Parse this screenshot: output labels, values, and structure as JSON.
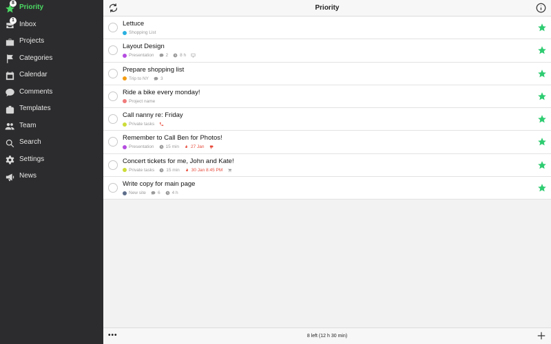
{
  "sidebar": {
    "items": [
      {
        "label": "Priority",
        "icon": "star-icon",
        "badge": "8",
        "active": true
      },
      {
        "label": "Inbox",
        "icon": "inbox-icon",
        "badge": "1"
      },
      {
        "label": "Projects",
        "icon": "briefcase-icon"
      },
      {
        "label": "Categories",
        "icon": "flag-icon"
      },
      {
        "label": "Calendar",
        "icon": "calendar-icon"
      },
      {
        "label": "Comments",
        "icon": "comment-icon"
      },
      {
        "label": "Templates",
        "icon": "templates-icon"
      },
      {
        "label": "Team",
        "icon": "team-icon"
      },
      {
        "label": "Search",
        "icon": "search-icon"
      },
      {
        "label": "Settings",
        "icon": "gear-icon"
      },
      {
        "label": "News",
        "icon": "megaphone-icon"
      }
    ]
  },
  "header": {
    "title": "Priority"
  },
  "tasks": [
    {
      "title": "Lettuce",
      "project": "Shopping List",
      "project_color": "#2ab0e0"
    },
    {
      "title": "Layout Design",
      "project": "Presentation",
      "project_color": "#b54de0",
      "comments": "2",
      "duration": "8 h"
    },
    {
      "title": "Prepare shopping list",
      "project": "Trip to NY",
      "project_color": "#f39c12",
      "comments": "3"
    },
    {
      "title": "Ride a bike every monday!",
      "project": "Project name",
      "project_color": "#f07b7b"
    },
    {
      "title": "Call nanny re: Friday",
      "project": "Private tasks",
      "project_color": "#cddc39"
    },
    {
      "title": "Remember to Call Ben for Photos!",
      "project": "Presentation",
      "project_color": "#b54de0",
      "duration": "15 min",
      "due": "27 Jan"
    },
    {
      "title": "Concert tickets for me, John and Kate!",
      "project": "Private tasks",
      "project_color": "#cddc39",
      "duration": "15 min",
      "due": "30 Jan 8:45 PM"
    },
    {
      "title": "Write copy for main page",
      "project": "New site",
      "project_color": "#5d6d8a",
      "comments": "6",
      "duration": "4 h"
    }
  ],
  "footer": {
    "more_label": "•••",
    "summary": "8 left (12 h 30 min)"
  },
  "colors": {
    "accent": "#4cd964",
    "star": "#2ecc71",
    "due": "#e74c3c",
    "sidebar_bg": "#2c2c2e"
  }
}
